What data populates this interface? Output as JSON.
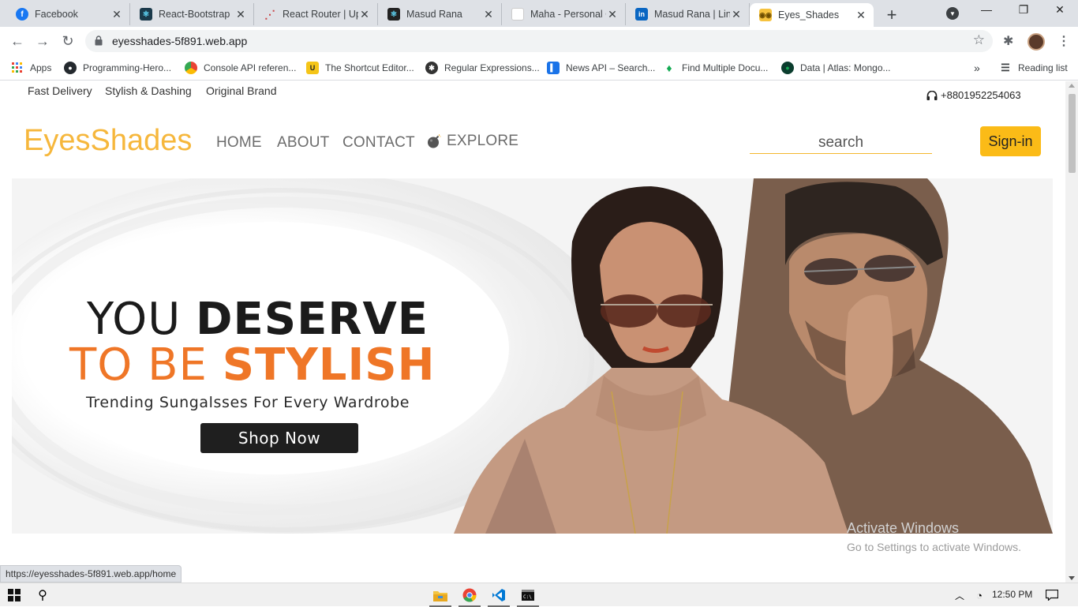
{
  "browser": {
    "tabs": [
      {
        "title": "Facebook",
        "icon": "facebook-icon",
        "color": "#1877f2",
        "glyph": "f"
      },
      {
        "title": "React-Bootstrap",
        "icon": "react-bootstrap-icon",
        "color": "#1b3a4b",
        "glyph": "⚛"
      },
      {
        "title": "React Router | Up",
        "icon": "react-router-icon",
        "color": "#ffffff",
        "glyph": "⋯"
      },
      {
        "title": "Masud Rana",
        "icon": "react-icon",
        "color": "#222222",
        "glyph": "⚛"
      },
      {
        "title": "Maha - Personal C",
        "icon": "blank-page-icon",
        "color": "#ffffff",
        "glyph": ""
      },
      {
        "title": "Masud Rana | Link",
        "icon": "linkedin-icon",
        "color": "#0a66c2",
        "glyph": "in"
      },
      {
        "title": "Eyes_Shades",
        "icon": "sunglasses-icon",
        "color": "#f6c23e",
        "glyph": "👓",
        "active": true
      }
    ],
    "url": "eyesshades-5f891.web.app",
    "bookmarks": [
      {
        "label": "Apps",
        "icon": "apps-grid-icon"
      },
      {
        "label": "Programming-Hero...",
        "icon": "github-icon"
      },
      {
        "label": "Console API referen...",
        "icon": "chrome-icon"
      },
      {
        "label": "The Shortcut Editor...",
        "icon": "u-icon"
      },
      {
        "label": "Regular Expressions...",
        "icon": "regex-icon"
      },
      {
        "label": "News API – Search...",
        "icon": "news-icon"
      },
      {
        "label": "Find Multiple Docu...",
        "icon": "mongodb-leaf-icon"
      },
      {
        "label": "Data | Atlas: Mongo...",
        "icon": "atlas-icon"
      }
    ],
    "reading_list": "Reading list",
    "status_url": "https://eyesshades-5f891.web.app/home"
  },
  "site": {
    "top_links": [
      "Fast Delivery",
      "Stylish & Dashing",
      "Original Brand"
    ],
    "phone": "+8801952254063",
    "logo": "EyesShades",
    "nav": [
      "HOME",
      "ABOUT",
      "CONTACT",
      "EXPLORE"
    ],
    "search_placeholder": "search",
    "signin": "Sign-in",
    "brand_color": "#fbbb17",
    "hero": {
      "line1_light": "YOU ",
      "line1_bold": "DESERVE",
      "line2_light": "TO BE ",
      "line2_bold": "STYLISH",
      "tagline": "Trending Sungalsses For Every Wardrobe",
      "cta": "Shop Now",
      "accent_color": "#ef7627"
    }
  },
  "windows": {
    "activate_title": "Activate Windows",
    "activate_sub": "Go to Settings to activate Windows.",
    "time": "12:50 PM"
  }
}
